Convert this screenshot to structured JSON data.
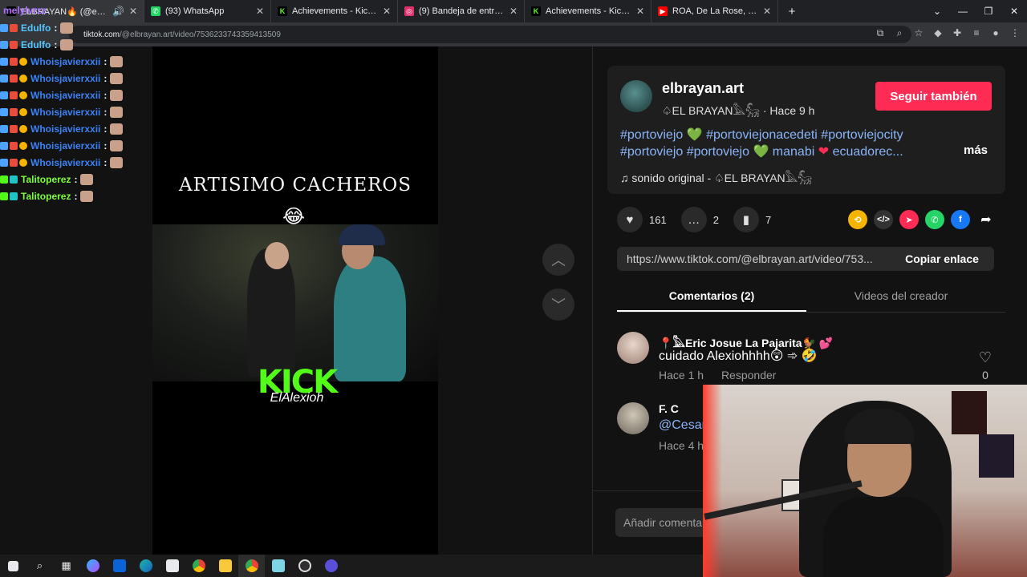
{
  "browser": {
    "tabs": [
      {
        "label": "ELBRAYAN🔥 (@elbrayan",
        "icon": "tiktok-icon",
        "color": "#ff0050",
        "active": true,
        "has_audio": true
      },
      {
        "label": "(93) WhatsApp",
        "icon": "whatsapp-icon",
        "color": "#25d366"
      },
      {
        "label": "Achievements - Kick Dashboard",
        "icon": "kick-icon",
        "color": "#53fc18"
      },
      {
        "label": "(9) Bandeja de entrada • Chats",
        "icon": "instagram-icon",
        "color": "#e1306c"
      },
      {
        "label": "Achievements - Kick Dashboard",
        "icon": "kick-icon",
        "color": "#53fc18"
      },
      {
        "label": "ROA, De La Rose, Luar La L, Yan",
        "icon": "youtube-icon",
        "color": "#ff0000"
      }
    ],
    "url_host": "tiktok.com",
    "url_path": "/@elbrayan.art/video/7536233743359413509"
  },
  "chat": {
    "top_user": "melylvrzz",
    "rows": [
      {
        "user": "Edulfo",
        "color": "#53c5ff"
      },
      {
        "user": "Edulfo",
        "color": "#53c5ff"
      },
      {
        "user": "Whoisjavierxxii",
        "color": "#3b82f6"
      },
      {
        "user": "Whoisjavierxxii",
        "color": "#3b82f6"
      },
      {
        "user": "Whoisjavierxxii",
        "color": "#3b82f6"
      },
      {
        "user": "Whoisjavierxxii",
        "color": "#3b82f6"
      },
      {
        "user": "Whoisjavierxxii",
        "color": "#3b82f6"
      },
      {
        "user": "Whoisjavierxxii",
        "color": "#3b82f6"
      },
      {
        "user": "Whoisjavierxxii",
        "color": "#3b82f6"
      },
      {
        "user": "Talitoperez",
        "color": "#7cfc3a"
      },
      {
        "user": "Talitoperez",
        "color": "#7cfc3a"
      }
    ],
    "colon": ":"
  },
  "video": {
    "title": "ARTISIMO CACHEROS",
    "emoji": "😂",
    "brand": "KICK",
    "brand_sub": "ElAlexioh"
  },
  "author": {
    "handle": "elbrayan.art",
    "subtitle": "♤EL BRAYAN𓅓𓃵 · Hace 9 h",
    "follow_label": "Seguir también",
    "tags_line1": "#portoviejo 💚 #portoviejonacedeti #portoviejocity",
    "tags_line2_a": "#portoviejo #portoviejo ",
    "tags_line2_b": " manabi ",
    "tags_line2_c": " ecuadorec...",
    "more_label": "más",
    "music": "♫  sonido original - ♤EL BRAYAN𓅓𓃵"
  },
  "actions": {
    "likes": "161",
    "comments": "2",
    "saves": "7"
  },
  "share": {
    "link": "https://www.tiktok.com/@elbrayan.art/video/753...",
    "copy_label": "Copiar enlace"
  },
  "panel_tabs": {
    "comments": "Comentarios (2)",
    "creator_videos": "Videos del creador"
  },
  "comments": [
    {
      "name": "📍𓅓Eric Josue La Pajarita🐓 💕",
      "text": "cuidado Alexiohhhh😲 ➾ 🤣",
      "time": "Hace 1 h",
      "reply": "Responder",
      "likes": "0"
    },
    {
      "name": "F. C",
      "text": "@Cesar",
      "time": "Hace 4 h"
    }
  ],
  "comment_input_placeholder": "Añadir comenta"
}
